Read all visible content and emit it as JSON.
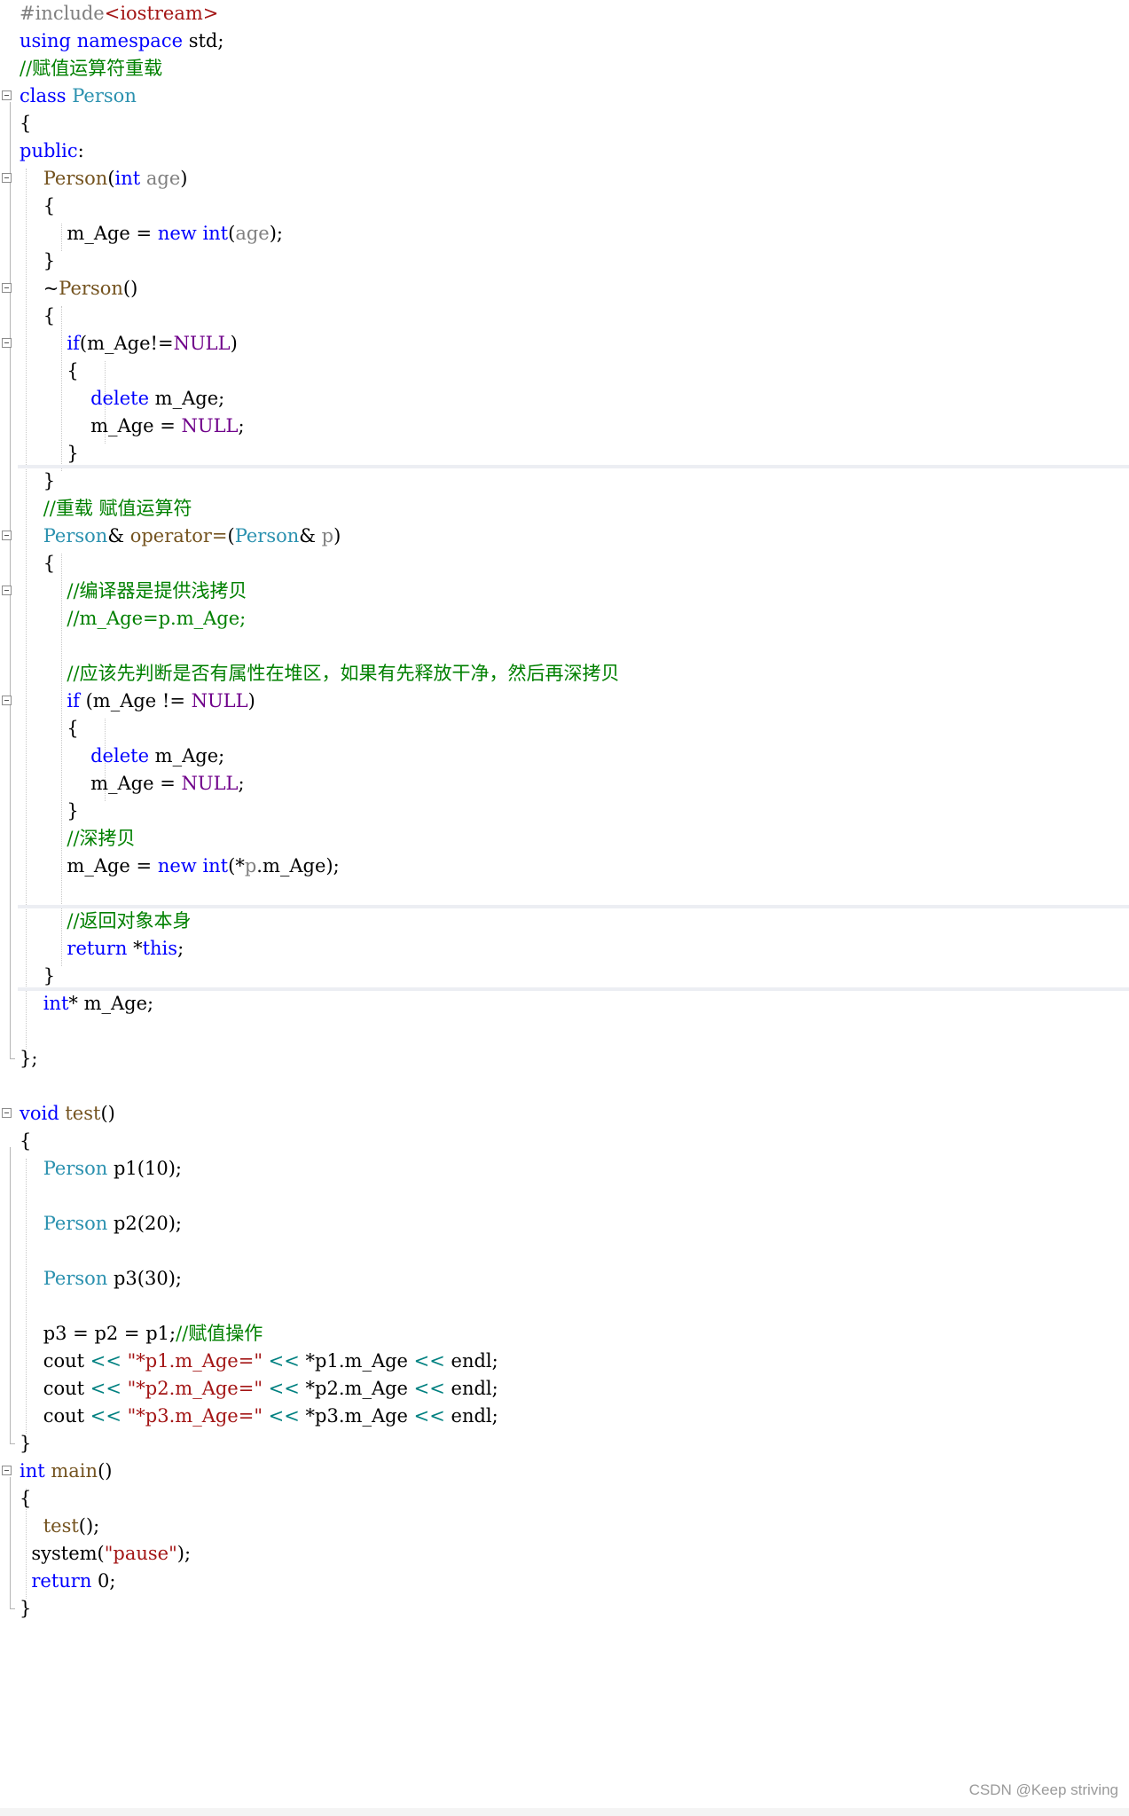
{
  "editor": {
    "lines": [
      {
        "fold": false,
        "tokens": [
          [
            "#include",
            "pp"
          ],
          [
            "<iostream>",
            "str"
          ]
        ]
      },
      {
        "fold": false,
        "tokens": [
          [
            "using",
            "kw"
          ],
          [
            " ",
            "pl"
          ],
          [
            "namespace",
            "kw"
          ],
          [
            " std;",
            "pl"
          ]
        ]
      },
      {
        "fold": false,
        "tokens": [
          [
            "//赋值运算符重载",
            "cmt"
          ]
        ]
      },
      {
        "fold": true,
        "tokens": [
          [
            "class",
            "kw"
          ],
          [
            " ",
            "pl"
          ],
          [
            "Person",
            "typ"
          ]
        ]
      },
      {
        "fold": false,
        "tokens": [
          [
            "{",
            "pl"
          ]
        ]
      },
      {
        "fold": false,
        "tokens": [
          [
            "public",
            "kw"
          ],
          [
            ":",
            "pl"
          ]
        ]
      },
      {
        "fold": true,
        "tokens": [
          [
            "    ",
            "pl"
          ],
          [
            "Person",
            "fn"
          ],
          [
            "(",
            "pl"
          ],
          [
            "int",
            "kw"
          ],
          [
            " ",
            "pl"
          ],
          [
            "age",
            "prm"
          ],
          [
            ")",
            "pl"
          ]
        ]
      },
      {
        "fold": false,
        "tokens": [
          [
            "    {",
            "pl"
          ]
        ]
      },
      {
        "fold": false,
        "tokens": [
          [
            "        m_Age = ",
            "pl"
          ],
          [
            "new",
            "kw"
          ],
          [
            " ",
            "pl"
          ],
          [
            "int",
            "kw"
          ],
          [
            "(",
            "pl"
          ],
          [
            "age",
            "prm"
          ],
          [
            ");",
            "pl"
          ]
        ]
      },
      {
        "fold": false,
        "tokens": [
          [
            "    }",
            "pl"
          ]
        ]
      },
      {
        "fold": true,
        "tokens": [
          [
            "    ~",
            "pl"
          ],
          [
            "Person",
            "fn"
          ],
          [
            "()",
            "pl"
          ]
        ]
      },
      {
        "fold": false,
        "tokens": [
          [
            "    {",
            "pl"
          ]
        ]
      },
      {
        "fold": true,
        "tokens": [
          [
            "        ",
            "pl"
          ],
          [
            "if",
            "kw"
          ],
          [
            "(m_Age!=",
            "pl"
          ],
          [
            "NULL",
            "mac"
          ],
          [
            ")",
            "pl"
          ]
        ]
      },
      {
        "fold": false,
        "tokens": [
          [
            "        {",
            "pl"
          ]
        ]
      },
      {
        "fold": false,
        "tokens": [
          [
            "            ",
            "pl"
          ],
          [
            "delete",
            "kw"
          ],
          [
            " m_Age;",
            "pl"
          ]
        ]
      },
      {
        "fold": false,
        "tokens": [
          [
            "            m_Age = ",
            "pl"
          ],
          [
            "NULL",
            "mac"
          ],
          [
            ";",
            "pl"
          ]
        ]
      },
      {
        "fold": false,
        "tokens": [
          [
            "        }",
            "pl"
          ]
        ]
      },
      {
        "fold": false,
        "tokens": [
          [
            "    }",
            "pl"
          ]
        ]
      },
      {
        "fold": false,
        "tokens": [
          [
            "    ",
            "pl"
          ],
          [
            "//重载 赋值运算符",
            "cmt"
          ]
        ]
      },
      {
        "fold": true,
        "tokens": [
          [
            "    ",
            "pl"
          ],
          [
            "Person",
            "typ"
          ],
          [
            "& ",
            "pl"
          ],
          [
            "operator=",
            "fn"
          ],
          [
            "(",
            "pl"
          ],
          [
            "Person",
            "typ"
          ],
          [
            "& ",
            "pl"
          ],
          [
            "p",
            "prm"
          ],
          [
            ")",
            "pl"
          ]
        ]
      },
      {
        "fold": false,
        "tokens": [
          [
            "    {",
            "pl"
          ]
        ]
      },
      {
        "fold": true,
        "tokens": [
          [
            "        ",
            "pl"
          ],
          [
            "//编译器是提供浅拷贝",
            "cmt"
          ]
        ]
      },
      {
        "fold": false,
        "tokens": [
          [
            "        ",
            "pl"
          ],
          [
            "//m_Age=p.m_Age;",
            "cmt"
          ]
        ]
      },
      {
        "fold": false,
        "tokens": [
          [
            "",
            "pl"
          ]
        ]
      },
      {
        "fold": false,
        "tokens": [
          [
            "        ",
            "pl"
          ],
          [
            "//应该先判断是否有属性在堆区，如果有先释放干净，然后再深拷贝",
            "cmt"
          ]
        ]
      },
      {
        "fold": true,
        "tokens": [
          [
            "        ",
            "pl"
          ],
          [
            "if",
            "kw"
          ],
          [
            " (m_Age != ",
            "pl"
          ],
          [
            "NULL",
            "mac"
          ],
          [
            ")",
            "pl"
          ]
        ]
      },
      {
        "fold": false,
        "tokens": [
          [
            "        {",
            "pl"
          ]
        ]
      },
      {
        "fold": false,
        "tokens": [
          [
            "            ",
            "pl"
          ],
          [
            "delete",
            "kw"
          ],
          [
            " m_Age;",
            "pl"
          ]
        ]
      },
      {
        "fold": false,
        "tokens": [
          [
            "            m_Age = ",
            "pl"
          ],
          [
            "NULL",
            "mac"
          ],
          [
            ";",
            "pl"
          ]
        ]
      },
      {
        "fold": false,
        "tokens": [
          [
            "        }",
            "pl"
          ]
        ]
      },
      {
        "fold": false,
        "tokens": [
          [
            "        ",
            "pl"
          ],
          [
            "//深拷贝",
            "cmt"
          ]
        ]
      },
      {
        "fold": false,
        "tokens": [
          [
            "        m_Age = ",
            "pl"
          ],
          [
            "new",
            "kw"
          ],
          [
            " ",
            "pl"
          ],
          [
            "int",
            "kw"
          ],
          [
            "(*",
            "pl"
          ],
          [
            "p",
            "prm"
          ],
          [
            ".m_Age);",
            "pl"
          ]
        ]
      },
      {
        "fold": false,
        "tokens": [
          [
            "",
            "pl"
          ]
        ]
      },
      {
        "fold": false,
        "tokens": [
          [
            "        ",
            "pl"
          ],
          [
            "//返回对象本身",
            "cmt"
          ]
        ]
      },
      {
        "fold": false,
        "tokens": [
          [
            "        ",
            "pl"
          ],
          [
            "return",
            "kw"
          ],
          [
            " *",
            "pl"
          ],
          [
            "this",
            "kw"
          ],
          [
            ";",
            "pl"
          ]
        ]
      },
      {
        "fold": false,
        "tokens": [
          [
            "    }",
            "pl"
          ]
        ]
      },
      {
        "fold": false,
        "tokens": [
          [
            "    ",
            "pl"
          ],
          [
            "int",
            "kw"
          ],
          [
            "* m_Age;",
            "pl"
          ]
        ]
      },
      {
        "fold": false,
        "tokens": [
          [
            "",
            "pl"
          ]
        ]
      },
      {
        "fold": false,
        "tokens": [
          [
            "};",
            "pl"
          ]
        ]
      },
      {
        "fold": false,
        "tokens": [
          [
            "",
            "pl"
          ]
        ]
      },
      {
        "fold": true,
        "tokens": [
          [
            "void",
            "kw"
          ],
          [
            " ",
            "pl"
          ],
          [
            "test",
            "fn"
          ],
          [
            "()",
            "pl"
          ]
        ]
      },
      {
        "fold": false,
        "tokens": [
          [
            "{",
            "pl"
          ]
        ]
      },
      {
        "fold": false,
        "tokens": [
          [
            "    ",
            "pl"
          ],
          [
            "Person",
            "typ"
          ],
          [
            " p1(10);",
            "pl"
          ]
        ]
      },
      {
        "fold": false,
        "tokens": [
          [
            "",
            "pl"
          ]
        ]
      },
      {
        "fold": false,
        "tokens": [
          [
            "    ",
            "pl"
          ],
          [
            "Person",
            "typ"
          ],
          [
            " p2(20);",
            "pl"
          ]
        ]
      },
      {
        "fold": false,
        "tokens": [
          [
            "",
            "pl"
          ]
        ]
      },
      {
        "fold": false,
        "tokens": [
          [
            "    ",
            "pl"
          ],
          [
            "Person",
            "typ"
          ],
          [
            " p3(30);",
            "pl"
          ]
        ]
      },
      {
        "fold": false,
        "tokens": [
          [
            "",
            "pl"
          ]
        ]
      },
      {
        "fold": false,
        "tokens": [
          [
            "    p3 = p2 = p1;",
            "pl"
          ],
          [
            "//赋值操作",
            "cmt"
          ]
        ]
      },
      {
        "fold": false,
        "tokens": [
          [
            "    cout ",
            "pl"
          ],
          [
            "<<",
            "op"
          ],
          [
            " ",
            "pl"
          ],
          [
            "\"*p1.m_Age=\"",
            "str"
          ],
          [
            " ",
            "pl"
          ],
          [
            "<<",
            "op"
          ],
          [
            " *p1.m_Age ",
            "pl"
          ],
          [
            "<<",
            "op"
          ],
          [
            " endl;",
            "pl"
          ]
        ]
      },
      {
        "fold": false,
        "tokens": [
          [
            "    cout ",
            "pl"
          ],
          [
            "<<",
            "op"
          ],
          [
            " ",
            "pl"
          ],
          [
            "\"*p2.m_Age=\"",
            "str"
          ],
          [
            " ",
            "pl"
          ],
          [
            "<<",
            "op"
          ],
          [
            " *p2.m_Age ",
            "pl"
          ],
          [
            "<<",
            "op"
          ],
          [
            " endl;",
            "pl"
          ]
        ]
      },
      {
        "fold": false,
        "tokens": [
          [
            "    cout ",
            "pl"
          ],
          [
            "<<",
            "op"
          ],
          [
            " ",
            "pl"
          ],
          [
            "\"*p3.m_Age=\"",
            "str"
          ],
          [
            " ",
            "pl"
          ],
          [
            "<<",
            "op"
          ],
          [
            " *p3.m_Age ",
            "pl"
          ],
          [
            "<<",
            "op"
          ],
          [
            " endl;",
            "pl"
          ]
        ]
      },
      {
        "fold": false,
        "tokens": [
          [
            "}",
            "pl"
          ]
        ]
      },
      {
        "fold": true,
        "tokens": [
          [
            "int",
            "kw"
          ],
          [
            " ",
            "pl"
          ],
          [
            "main",
            "fn"
          ],
          [
            "()",
            "pl"
          ]
        ]
      },
      {
        "fold": false,
        "tokens": [
          [
            "{",
            "pl"
          ]
        ]
      },
      {
        "fold": false,
        "tokens": [
          [
            "    ",
            "pl"
          ],
          [
            "test",
            "fn"
          ],
          [
            "();",
            "pl"
          ]
        ]
      },
      {
        "fold": false,
        "tokens": [
          [
            "  system(",
            "pl"
          ],
          [
            "\"pause\"",
            "str"
          ],
          [
            ");",
            "pl"
          ]
        ]
      },
      {
        "fold": false,
        "tokens": [
          [
            "  ",
            "pl"
          ],
          [
            "return",
            "kw"
          ],
          [
            " 0;",
            "pl"
          ]
        ]
      },
      {
        "fold": false,
        "tokens": [
          [
            "}",
            "pl"
          ]
        ]
      }
    ]
  },
  "watermark": "CSDN @Keep striving",
  "colors": {
    "keyword": "#0000ff",
    "type": "#2b91af",
    "comment": "#008000",
    "string": "#a31515",
    "macro": "#6f008a",
    "preprocessor": "#808080"
  }
}
